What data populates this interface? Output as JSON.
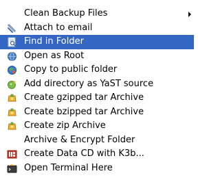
{
  "menu": {
    "items": [
      {
        "label": "Clean Backup Files",
        "icon": "none",
        "has_submenu": true
      },
      {
        "label": "Attach to email",
        "icon": "paperclip-icon"
      },
      {
        "label": "Find in Folder",
        "icon": "find-document-icon",
        "highlighted": true
      },
      {
        "label": "Open as Root",
        "icon": "globe-icon"
      },
      {
        "label": "Copy to public folder",
        "icon": "globe-copy-icon"
      },
      {
        "label": "Add directory as YaST source",
        "icon": "yast-icon"
      },
      {
        "label": "Create gzipped tar Archive",
        "icon": "archive-icon"
      },
      {
        "label": "Create bzipped tar Archive",
        "icon": "archive-icon"
      },
      {
        "label": "Create zip Archive",
        "icon": "archive-icon"
      },
      {
        "label": "Archive & Encrypt Folder",
        "icon": "none"
      },
      {
        "label": "Create Data CD with K3b...",
        "icon": "k3b-icon"
      },
      {
        "label": "Open Terminal Here",
        "icon": "terminal-icon"
      }
    ]
  },
  "colors": {
    "highlight": "#3467c4",
    "highlight_text": "#ffffff",
    "text": "#000000",
    "background": "#ffffff"
  }
}
